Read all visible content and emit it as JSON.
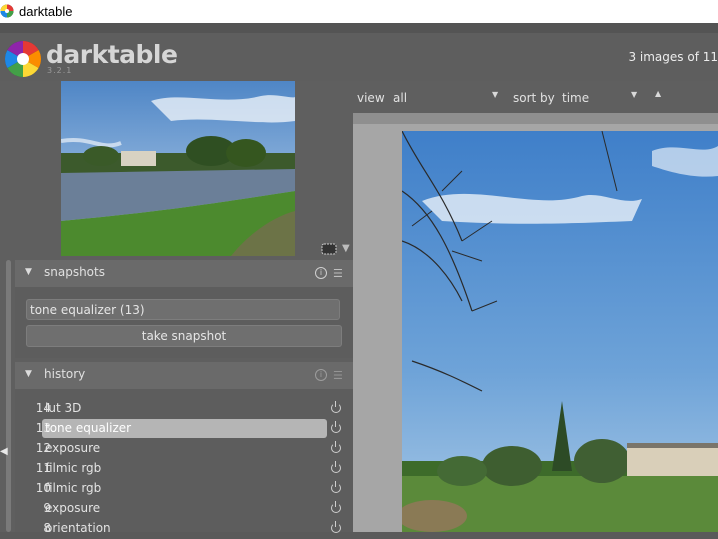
{
  "window": {
    "title": "darktable"
  },
  "header": {
    "brand": "darktable",
    "version": "3.2.1",
    "image_count": "3 images of 11"
  },
  "toolbar": {
    "view_label": "view",
    "view_value": "all",
    "sort_label": "sort by",
    "sort_value": "time"
  },
  "snapshots": {
    "title": "snapshots",
    "field_value": "tone equalizer (13)",
    "button_label": "take snapshot"
  },
  "history": {
    "title": "history",
    "items": [
      {
        "num": "14",
        "label": "lut 3D",
        "selected": false
      },
      {
        "num": "13",
        "label": "tone equalizer",
        "selected": true
      },
      {
        "num": "12",
        "label": "exposure",
        "selected": false
      },
      {
        "num": "11",
        "label": "filmic rgb",
        "selected": false
      },
      {
        "num": "10",
        "label": "filmic rgb",
        "selected": false
      },
      {
        "num": "9",
        "label": "exposure",
        "selected": false
      },
      {
        "num": "8",
        "label": "orientation",
        "selected": false
      }
    ]
  },
  "icons": {
    "app": "darktable-icon",
    "module_info": "info-icon",
    "module_menu": "hamburger-icon",
    "history_toggle": "power-icon",
    "sort_direction": "sort-up-icon"
  },
  "colors": {
    "selected_row": "#b5b5b5",
    "panel": "#5f5f5f",
    "center_bg": "#a6a6a6"
  }
}
